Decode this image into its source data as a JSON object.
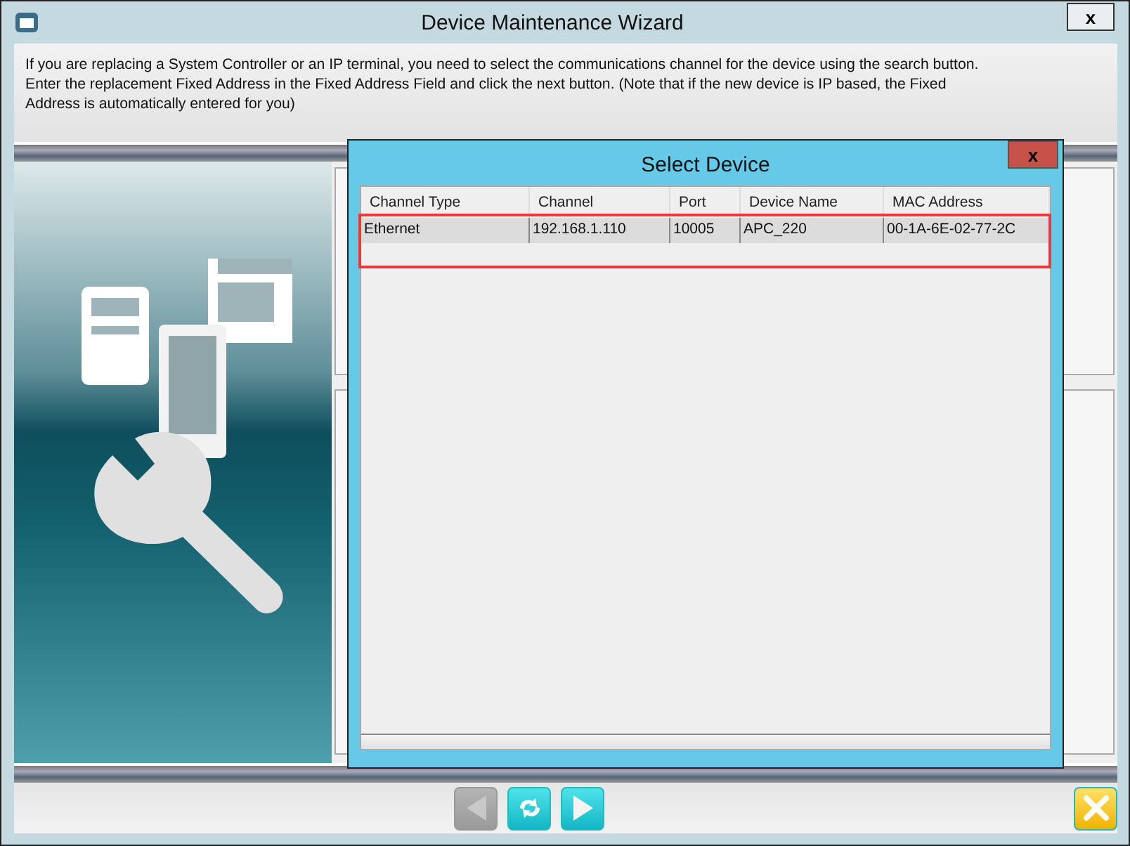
{
  "window": {
    "title": "Device Maintenance Wizard",
    "close": "x"
  },
  "instructions": "If you are replacing a System Controller or an IP terminal, you need to select the communications channel for the device using the search button. Enter the replacement Fixed Address in the Fixed Address Field and click the next button. (Note that if the new device is IP based, the Fixed Address is automatically entered for you)",
  "dialog": {
    "title": "Select Device",
    "close": "x",
    "columns": [
      "Channel Type",
      "Channel",
      "Port",
      "Device Name",
      "MAC Address"
    ],
    "rows": [
      {
        "cells": [
          "Ethernet",
          "192.168.1.110",
          "10005",
          "APC_220",
          "00-1A-6E-02-77-2C"
        ],
        "selected": true
      }
    ],
    "highlight": true
  },
  "nav_buttons": [
    {
      "kind": "back",
      "disabled": true
    },
    {
      "kind": "refresh",
      "disabled": false
    },
    {
      "kind": "next",
      "disabled": false
    }
  ],
  "cancel_button": {
    "kind": "cancel",
    "disabled": false
  }
}
